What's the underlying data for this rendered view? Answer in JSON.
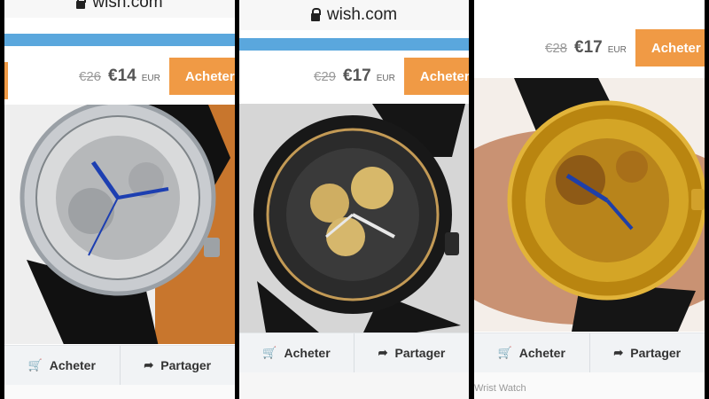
{
  "panels": [
    {
      "domain": "wish.com",
      "price": {
        "old": "€26",
        "new": "€14",
        "currency": "EUR"
      },
      "buy_label": "Acheter",
      "actions": {
        "buy": "Acheter",
        "share": "Partager"
      }
    },
    {
      "domain": "wish.com",
      "price": {
        "old": "€29",
        "new": "€17",
        "currency": "EUR"
      },
      "buy_label": "Acheter",
      "actions": {
        "buy": "Acheter",
        "share": "Partager"
      }
    },
    {
      "price": {
        "old": "€28",
        "new": "€17",
        "currency": "EUR"
      },
      "buy_label": "Acheter",
      "actions": {
        "buy": "Acheter",
        "share": "Partager"
      },
      "footer_fragment": "Wrist Watch"
    }
  ],
  "colors": {
    "accent": "#f09a45",
    "bluebar": "#5aa7dd",
    "background": "#000000"
  },
  "icons": [
    "lock-icon",
    "cart-icon",
    "share-arrow-icon"
  ]
}
